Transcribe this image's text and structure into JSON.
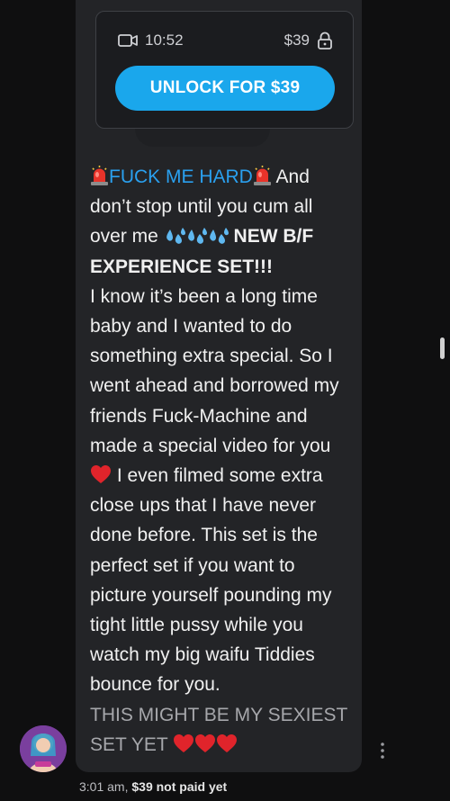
{
  "ppv": {
    "duration": "10:52",
    "price": "$39",
    "unlock_label": "UNLOCK FOR $39",
    "icons": {
      "video": "video-camera-icon",
      "lock": "lock-icon"
    }
  },
  "message": {
    "title": "FUCK ME HARD",
    "line1_rest": " And don’t stop until you cum all over me ",
    "set_title": "NEW B/F EXPERIENCE SET!!!",
    "body1": "I know it’s been a long time baby and I wanted to do something extra special. So I went ahead and borrowed my friends Fuck-Machine and made a special video for you ",
    "body2": " I even filmed some extra close ups that I have never done before. This set is the perfect set if you want to picture yourself pounding my tight little pussy while you watch my big waifu Tiddies bounce for you.",
    "closing": "THIS MIGHT BE MY SEXIEST SET YET "
  },
  "footer": {
    "time": "3:01 am,",
    "price_status": "$39 not paid yet"
  },
  "colors": {
    "accent": "#1aa7ec",
    "title_blue": "#2aa0ef",
    "bubble": "#232427",
    "background": "#0f0f10"
  }
}
